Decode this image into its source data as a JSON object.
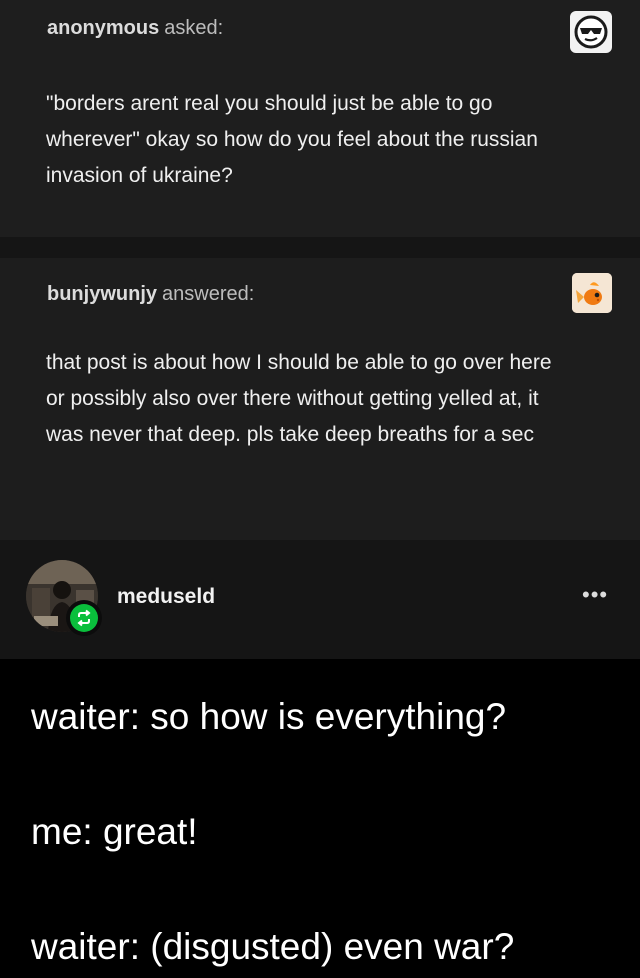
{
  "ask": {
    "asker": "anonymous",
    "verb": "asked:",
    "text": "\"borders arent real you should just be able to go wherever\" okay so how do you feel about the russian invasion of ukraine?",
    "avatar_icon": "sunglasses-face-icon"
  },
  "answer": {
    "answerer": "bunjywunjy",
    "verb": "answered:",
    "text": "that post is about how I should be able to go over here or possibly also over there without getting yelled at, it was never that deep. pls take deep breaths for a sec",
    "avatar_icon": "goldfish-icon"
  },
  "reblog": {
    "username": "meduseld",
    "more_label": "•••",
    "badge_icon": "reblog-icon",
    "badge_color": "#0abf3c"
  },
  "meme": {
    "line1": "waiter: so how is everything?",
    "line2": "me: great!",
    "line3": "waiter: (disgusted) even war?"
  }
}
